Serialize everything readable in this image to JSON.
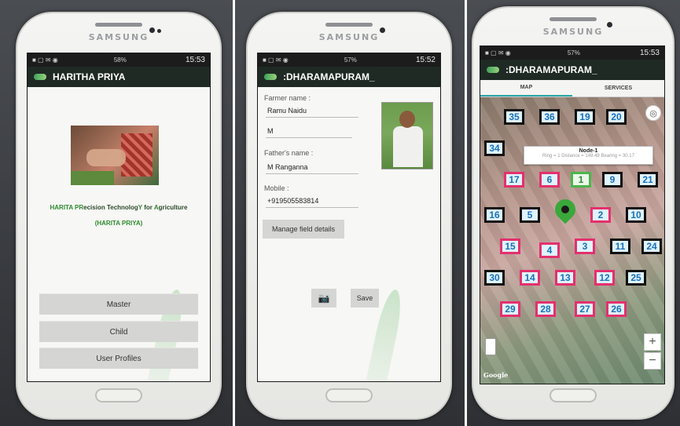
{
  "device": {
    "brand": "SAMSUNG"
  },
  "screen1": {
    "status_time": "15:53",
    "status_battery": "58%",
    "app_title": "HARITHA PRIYA",
    "tagline_parts": [
      "HARITA PR",
      "ecision Technolog",
      "Y",
      " for ",
      "A",
      "griculture"
    ],
    "subtitle": "(HARITA PRIYA)",
    "buttons": [
      "Master",
      "Child",
      "User Profiles"
    ]
  },
  "screen2": {
    "status_time": "15:52",
    "status_battery": "57%",
    "title": ":DHARAMAPURAM_",
    "farmer_name_label": "Farmer name :",
    "farmer_name": "Ramu Naidu",
    "gender": "M",
    "father_label": "Father's name :",
    "father_name": "M Ranganna",
    "mobile_label": "Mobile :",
    "mobile": "+919505583814",
    "manage_button": "Manage field details",
    "save_button": "Save"
  },
  "screen3": {
    "status_time": "15:53",
    "status_battery": "57%",
    "title": ":DHARAMAPURAM_",
    "tabs": [
      "MAP",
      "SERVICES"
    ],
    "tooltip_title": "Node-1",
    "tooltip_detail": "Ring = 1 Distance = 149.49 Bearing = 30.17",
    "google_label": "Google",
    "nodes": [
      {
        "id": "35",
        "style": "dark"
      },
      {
        "id": "36",
        "style": "dark"
      },
      {
        "id": "19",
        "style": "dark"
      },
      {
        "id": "20",
        "style": "dark"
      },
      {
        "id": "34",
        "style": "dark"
      },
      {
        "id": "17",
        "style": "pink"
      },
      {
        "id": "6",
        "style": "pink"
      },
      {
        "id": "1",
        "style": "green"
      },
      {
        "id": "9",
        "style": "dark"
      },
      {
        "id": "21",
        "style": "dark"
      },
      {
        "id": "16",
        "style": "dark"
      },
      {
        "id": "5",
        "style": "dark"
      },
      {
        "id": "2",
        "style": "pink"
      },
      {
        "id": "10",
        "style": "dark"
      },
      {
        "id": "15",
        "style": "pink"
      },
      {
        "id": "4",
        "style": "pink"
      },
      {
        "id": "3",
        "style": "pink"
      },
      {
        "id": "11",
        "style": "dark"
      },
      {
        "id": "24",
        "style": "dark"
      },
      {
        "id": "30",
        "style": "dark"
      },
      {
        "id": "14",
        "style": "pink"
      },
      {
        "id": "13",
        "style": "pink"
      },
      {
        "id": "12",
        "style": "pink"
      },
      {
        "id": "25",
        "style": "dark"
      },
      {
        "id": "29",
        "style": "pink"
      },
      {
        "id": "28",
        "style": "pink"
      },
      {
        "id": "27",
        "style": "pink"
      },
      {
        "id": "26",
        "style": "pink"
      }
    ]
  }
}
